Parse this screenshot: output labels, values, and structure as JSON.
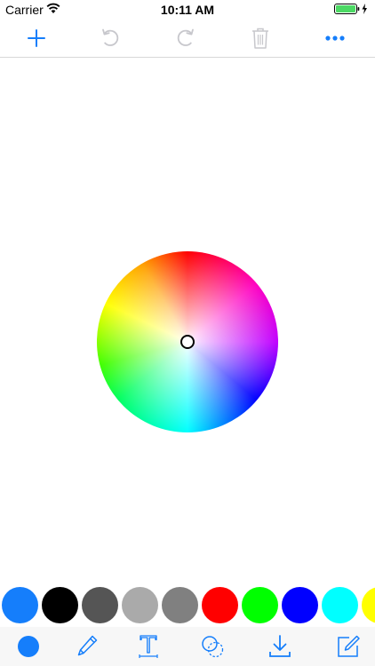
{
  "status_bar": {
    "carrier": "Carrier",
    "time": "10:11 AM",
    "icons": [
      "wifi-icon",
      "battery-icon",
      "charging-bolt-icon"
    ]
  },
  "nav_bar": {
    "buttons": [
      {
        "name": "add",
        "icon": "plus-icon",
        "enabled": true
      },
      {
        "name": "undo",
        "icon": "undo-icon",
        "enabled": false
      },
      {
        "name": "redo",
        "icon": "redo-icon",
        "enabled": false
      },
      {
        "name": "delete",
        "icon": "trash-icon",
        "enabled": false
      },
      {
        "name": "more",
        "icon": "more-icon",
        "enabled": true
      }
    ]
  },
  "color_wheel": {
    "selected_color": "#ffffff",
    "hues": [
      "#ff0000",
      "#ff00c0",
      "#c000ff",
      "#0000ff",
      "#00ffff",
      "#00ff60",
      "#40ff00",
      "#ffff00",
      "#ffa000"
    ]
  },
  "palette": {
    "colors": [
      "#157efb",
      "#000000",
      "#555555",
      "#aaaaaa",
      "#808080",
      "#ff0000",
      "#00ff00",
      "#0000ff",
      "#00ffff",
      "#ffff00"
    ]
  },
  "toolbar": {
    "accent_color": "#157efb",
    "tools": [
      {
        "name": "color",
        "icon": "color-dot-icon"
      },
      {
        "name": "pencil",
        "icon": "pencil-icon"
      },
      {
        "name": "text",
        "icon": "text-tool-icon"
      },
      {
        "name": "shapes",
        "icon": "shapes-icon"
      },
      {
        "name": "download",
        "icon": "download-icon"
      },
      {
        "name": "edit",
        "icon": "compose-icon"
      }
    ]
  },
  "colors": {
    "accent": "#157efb",
    "disabled": "#c7c7cc",
    "battery": "#4cd964"
  }
}
